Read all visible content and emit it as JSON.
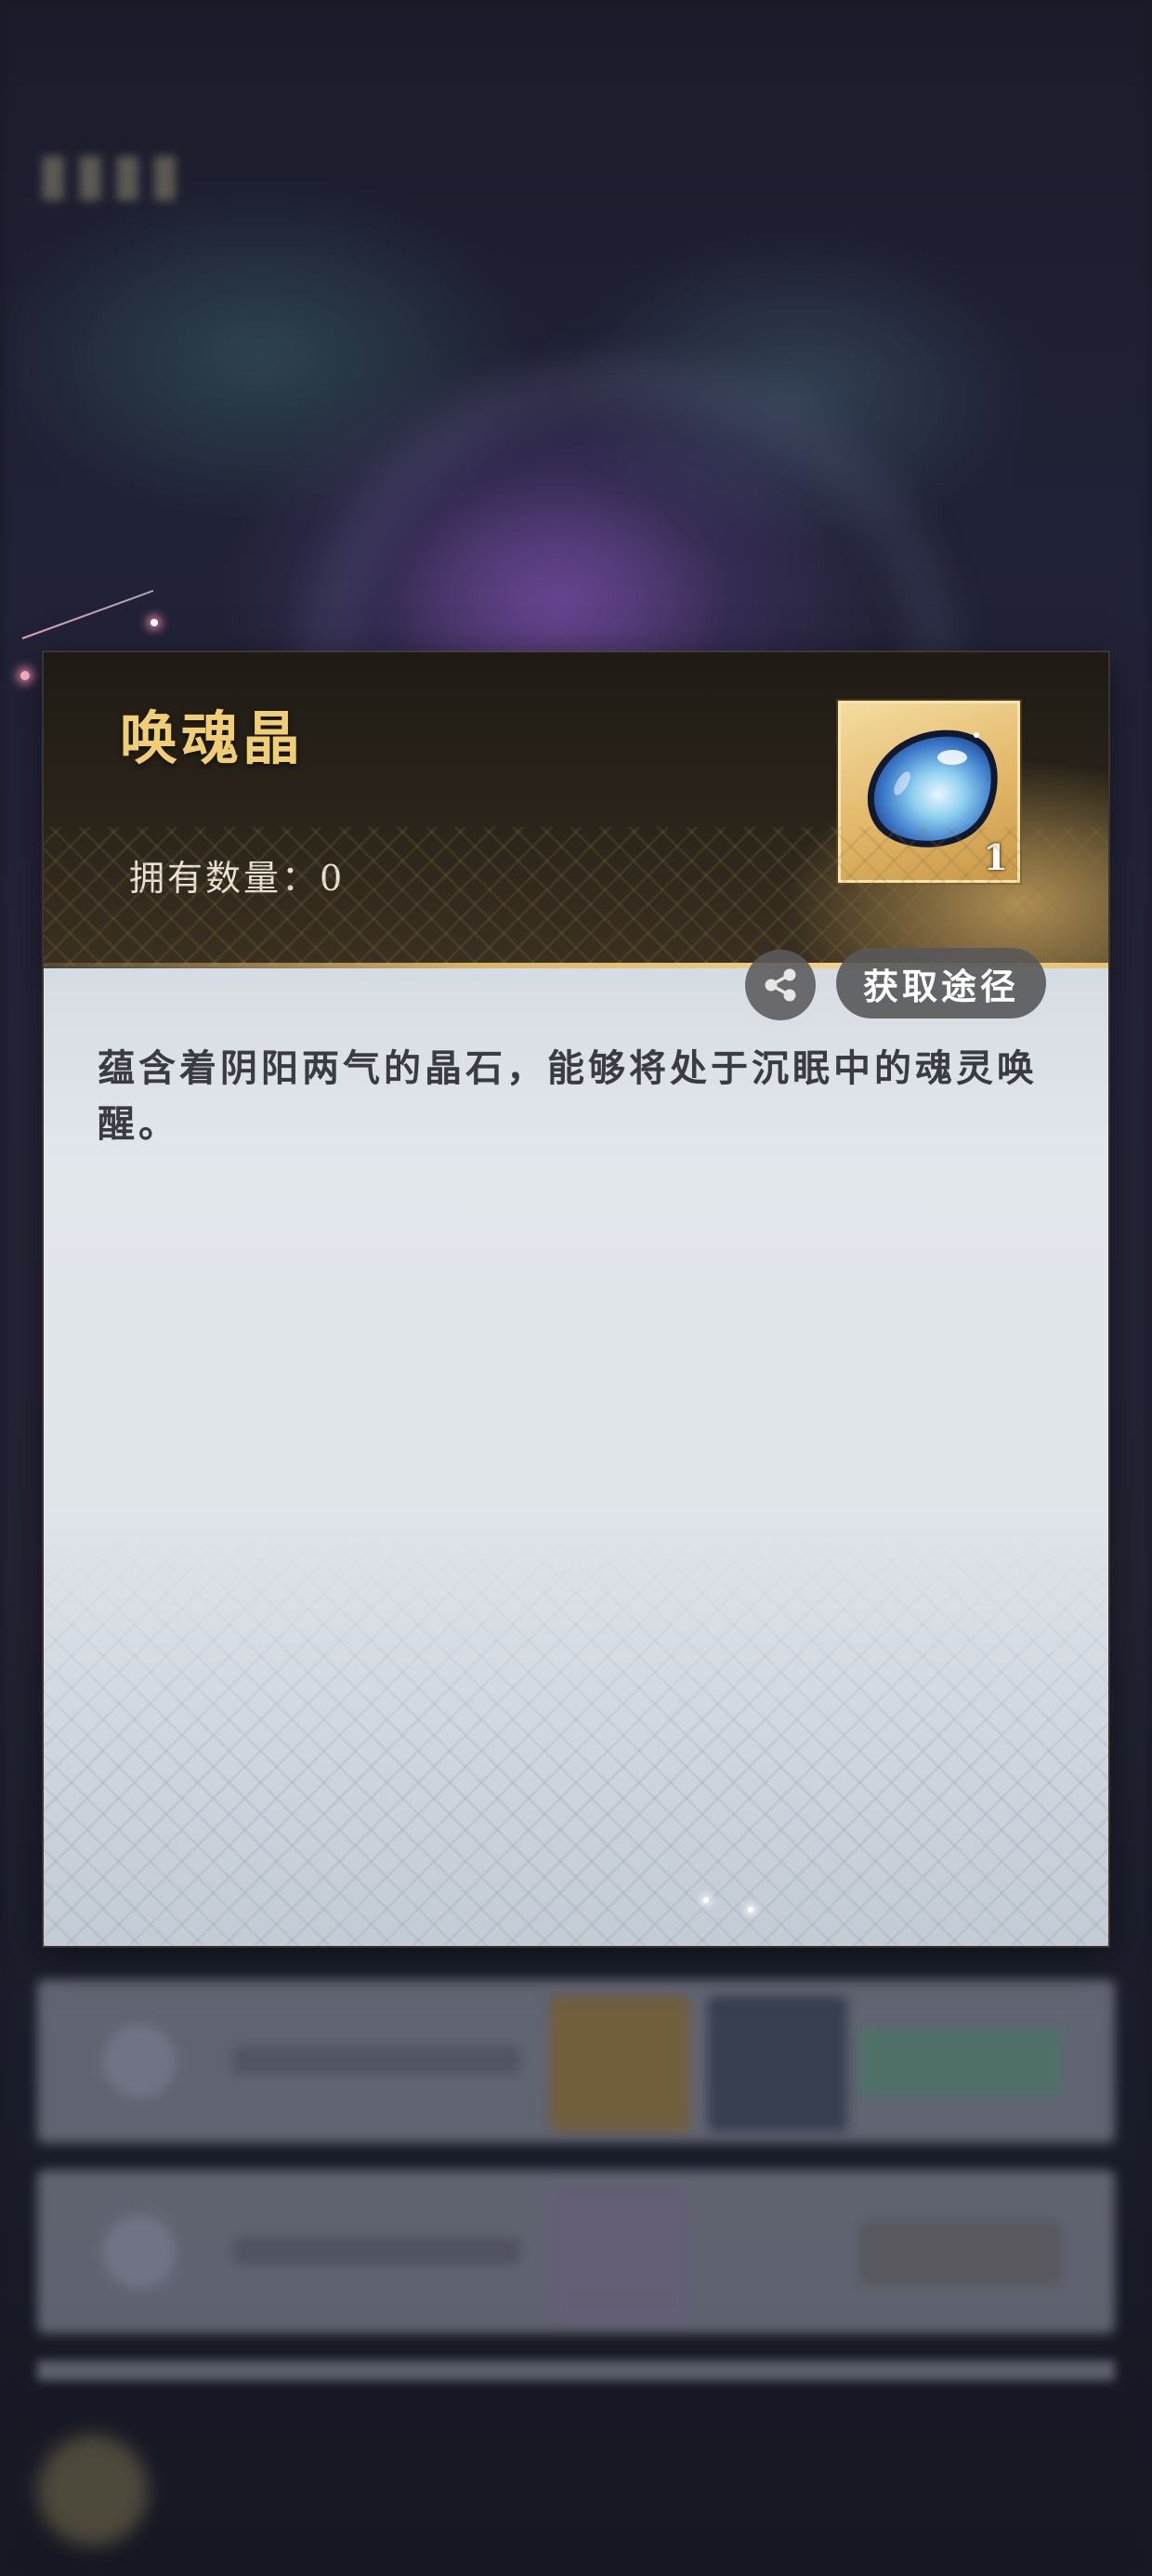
{
  "item": {
    "name": "唤魂晶",
    "owned_label": "拥有数量：",
    "owned_count": "0",
    "icon": "soul-crystal-icon",
    "stack_count": "1",
    "description": "蕴含着阴阳两气的晶石，能够将处于沉眠中的魂灵唤醒。"
  },
  "actions": {
    "share_icon": "share-icon",
    "obtain_label": "获取途径"
  },
  "colors": {
    "title_gold": "#f0cf74",
    "header_dark": "#231e16",
    "body_light": "#e0e5ea",
    "button_gray": "#58585a"
  }
}
